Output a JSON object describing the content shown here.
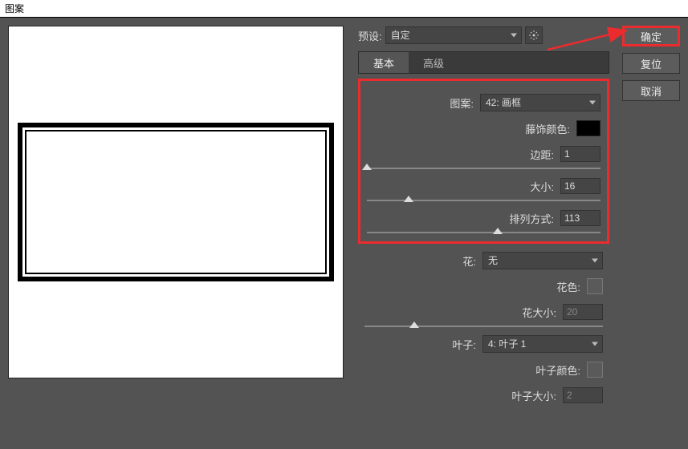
{
  "window": {
    "title": "图案"
  },
  "preset": {
    "label": "预设:",
    "value": "自定"
  },
  "tabs": {
    "basic": "基本",
    "advanced": "高级"
  },
  "basic_panel": {
    "pattern": {
      "label": "图案:",
      "value": "42: 画框"
    },
    "vine_color": {
      "label": "藤饰颜色:",
      "value": "#000000"
    },
    "margin": {
      "label": "边距:",
      "value": "1",
      "slider": 0
    },
    "size": {
      "label": "大小:",
      "value": "16",
      "slider": 18
    },
    "arrangement": {
      "label": "排列方式:",
      "value": "113",
      "slider": 56
    }
  },
  "flower": {
    "label": "花:",
    "value": "无",
    "color_label": "花色:",
    "color": "#888888",
    "size_label": "花大小:",
    "size": "20",
    "slider": 21
  },
  "leaf": {
    "label": "叶子:",
    "value": "4: 叶子 1",
    "color_label": "叶子颜色:",
    "color": "#888888",
    "size_label": "叶子大小:",
    "size": "2"
  },
  "buttons": {
    "ok": "确定",
    "reset": "复位",
    "cancel": "取消"
  }
}
